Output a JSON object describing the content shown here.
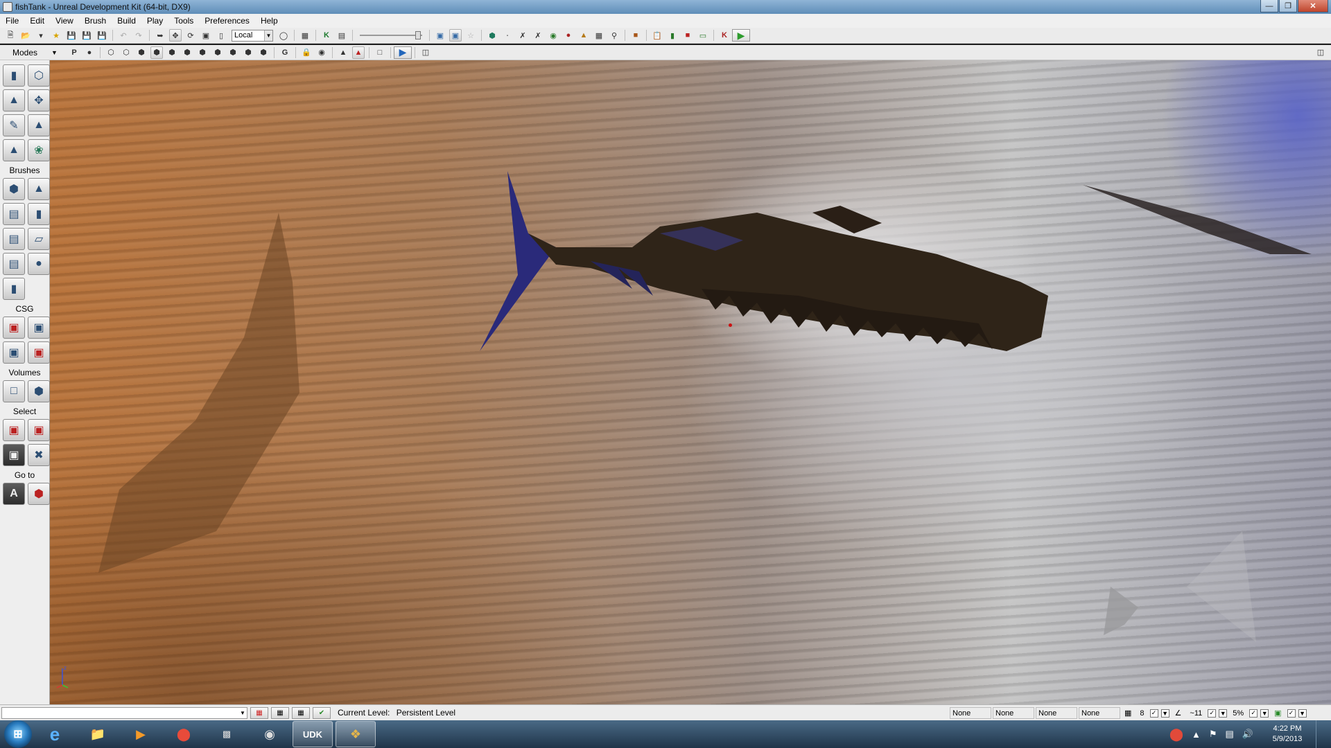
{
  "window": {
    "title": "fishTank - Unreal Development Kit (64-bit, DX9)",
    "controls": [
      "minimize",
      "maximize",
      "close"
    ]
  },
  "menu": [
    "File",
    "Edit",
    "View",
    "Brush",
    "Build",
    "Play",
    "Tools",
    "Preferences",
    "Help"
  ],
  "toolbar": {
    "coord_system": "Local"
  },
  "toolbar2": {
    "modes_label": "Modes",
    "p_label": "P",
    "g_label": "G"
  },
  "sidebar": {
    "brushes_label": "Brushes",
    "csg_label": "CSG",
    "volumes_label": "Volumes",
    "select_label": "Select",
    "goto_label": "Go to"
  },
  "statusbar": {
    "current_level_label": "Current Level:",
    "current_level_value": "Persistent Level",
    "snap_fields": [
      "None",
      "None",
      "None",
      "None"
    ],
    "grid_value": "8",
    "rotation_value": "~11",
    "scale_value": "5%"
  },
  "taskbar": {
    "apps": [
      "Internet Explorer",
      "Windows Explorer",
      "Windows Media Player",
      "Google Chrome",
      "Command Prompt",
      "Steam",
      "UDK",
      "3ds Max"
    ],
    "udk_label": "UDK",
    "time": "4:22 PM",
    "date": "5/9/2013"
  }
}
